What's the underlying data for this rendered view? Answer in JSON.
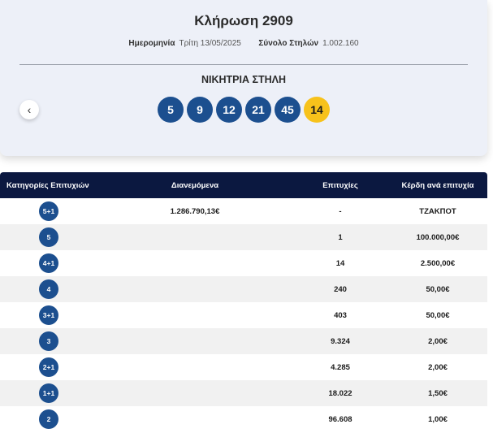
{
  "draw": {
    "title": "Κλήρωση 2909",
    "date_label": "Ημερομηνία",
    "date_value": "Τρίτη 13/05/2025",
    "columns_label": "Σύνολο Στηλών",
    "columns_value": "1.002.160",
    "winning_title": "ΝΙΚΗΤΡΙΑ ΣΤΗΛΗ",
    "prev_icon": "chevron-left-icon",
    "numbers": [
      "5",
      "9",
      "12",
      "21",
      "45"
    ],
    "bonus": "14",
    "colors": {
      "ball": "#1c4f8f",
      "bonus": "#f7c21b",
      "header": "#0b1840"
    }
  },
  "table": {
    "headers": [
      "Κατηγορίες Επιτυχιών",
      "Διανεμόμενα",
      "Επιτυχίες",
      "Κέρδη ανά επιτυχία"
    ],
    "rows": [
      {
        "category": "5+1",
        "distributed": "1.286.790,13€",
        "winners": "-",
        "prize": "ΤΖΑΚΠΟΤ"
      },
      {
        "category": "5",
        "distributed": "",
        "winners": "1",
        "prize": "100.000,00€"
      },
      {
        "category": "4+1",
        "distributed": "",
        "winners": "14",
        "prize": "2.500,00€"
      },
      {
        "category": "4",
        "distributed": "",
        "winners": "240",
        "prize": "50,00€"
      },
      {
        "category": "3+1",
        "distributed": "",
        "winners": "403",
        "prize": "50,00€"
      },
      {
        "category": "3",
        "distributed": "",
        "winners": "9.324",
        "prize": "2,00€"
      },
      {
        "category": "2+1",
        "distributed": "",
        "winners": "4.285",
        "prize": "2,00€"
      },
      {
        "category": "1+1",
        "distributed": "",
        "winners": "18.022",
        "prize": "1,50€"
      },
      {
        "category": "2",
        "distributed": "",
        "winners": "96.608",
        "prize": "1,00€"
      }
    ]
  }
}
